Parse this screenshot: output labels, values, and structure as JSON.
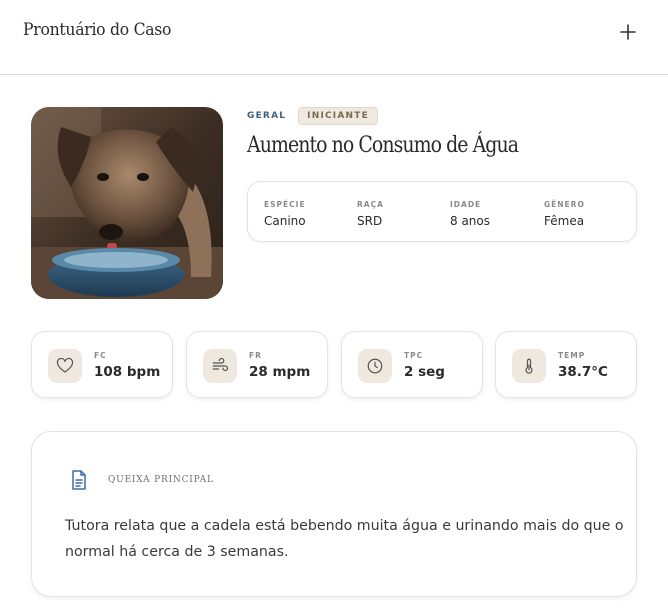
{
  "header": {
    "title": "Prontuário do Caso",
    "add_icon": "plus-icon"
  },
  "case": {
    "tag_primary": "GERAL",
    "tag_level": "INICIANTE",
    "title": "Aumento no Consumo de Água",
    "photo_alt": "Cão bebendo água de uma tigela azul"
  },
  "patient": [
    {
      "label": "ESPÉCIE",
      "value": "Canino"
    },
    {
      "label": "RAÇA",
      "value": "SRD"
    },
    {
      "label": "IDADE",
      "value": "8 anos"
    },
    {
      "label": "GÊNERO",
      "value": "Fêmea"
    }
  ],
  "vitals": [
    {
      "icon": "heart-icon",
      "label": "FC",
      "value": "108 bpm"
    },
    {
      "icon": "wind-icon",
      "label": "FR",
      "value": "28 mpm"
    },
    {
      "icon": "clock-icon",
      "label": "TPC",
      "value": "2 seg"
    },
    {
      "icon": "thermometer-icon",
      "label": "TEMP",
      "value": "38.7°C"
    }
  ],
  "complaint": {
    "icon": "document-icon",
    "label": "QUEIXA PRINCIPAL",
    "text": "Tutora relata que a cadela está bebendo muita água e urinando mais do que o normal há cerca de 3 semanas."
  },
  "colors": {
    "accent": "#3f5f7e",
    "icon_bg": "#eee8df",
    "tag_bg": "#efe9df",
    "doc_icon": "#3a6ea5"
  }
}
